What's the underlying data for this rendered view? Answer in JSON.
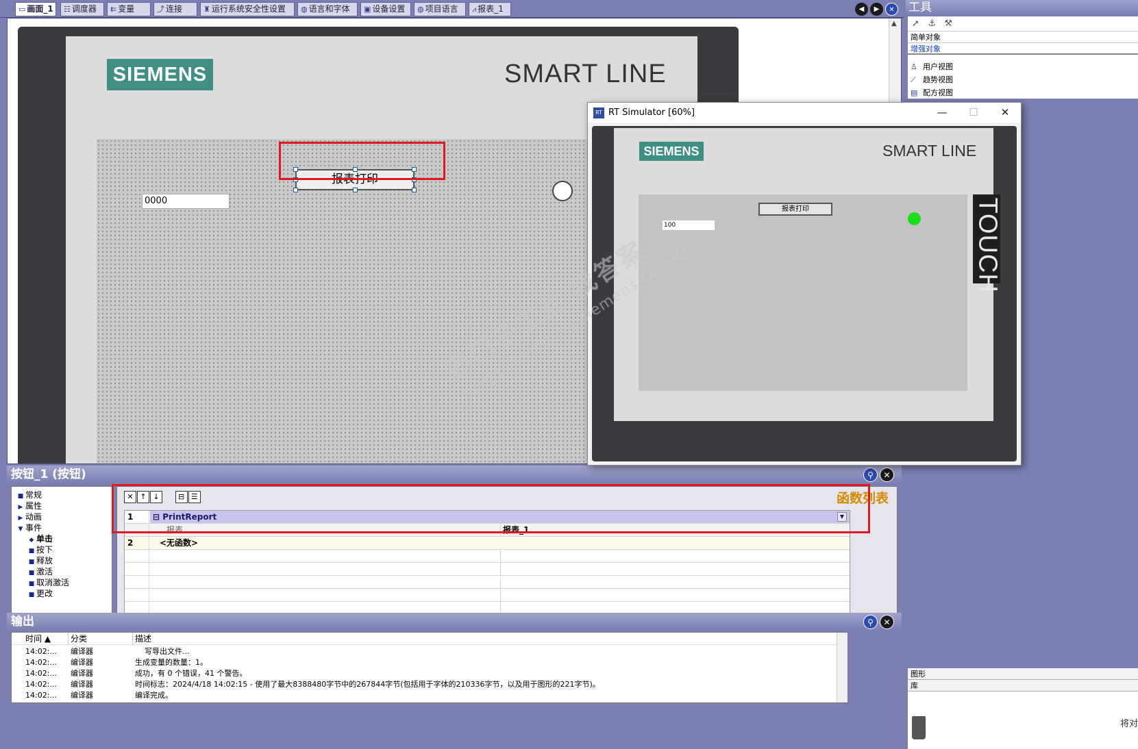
{
  "tabs": [
    {
      "label": "画面_1",
      "icon": "screen-icon",
      "active": true
    },
    {
      "label": "调度器",
      "icon": "scheduler-icon"
    },
    {
      "label": "变量",
      "icon": "variables-icon"
    },
    {
      "label": "连接",
      "icon": "connections-icon"
    },
    {
      "label": "运行系统安全性设置",
      "icon": "security-icon"
    },
    {
      "label": "语言和字体",
      "icon": "globe-icon"
    },
    {
      "label": "设备设置",
      "icon": "device-icon"
    },
    {
      "label": "项目语言",
      "icon": "globe-icon"
    },
    {
      "label": "报表_1",
      "icon": "report-icon"
    }
  ],
  "editor": {
    "logo_text": "SIEMENS",
    "device_label": "SMART LINE",
    "button_text": "报表打印",
    "io_field_value": "0000"
  },
  "properties": {
    "title": "按钮_1 (按钮)",
    "tree": [
      {
        "label": "常规",
        "marker": "■",
        "level": 0
      },
      {
        "label": "属性",
        "marker": "▶",
        "level": 0
      },
      {
        "label": "动画",
        "marker": "▶",
        "level": 0
      },
      {
        "label": "事件",
        "marker": "▼",
        "level": 0
      },
      {
        "label": "单击",
        "marker": "◆",
        "level": 1,
        "selected": true
      },
      {
        "label": "按下",
        "marker": "■",
        "level": 1
      },
      {
        "label": "释放",
        "marker": "■",
        "level": 1
      },
      {
        "label": "激活",
        "marker": "■",
        "level": 1
      },
      {
        "label": "取消激活",
        "marker": "■",
        "level": 1
      },
      {
        "label": "更改",
        "marker": "■",
        "level": 1
      }
    ],
    "function_list_title": "函数列表",
    "function_rows": [
      {
        "num": "1",
        "function": "PrintReport"
      },
      {
        "param_name": "报表",
        "param_value": "报表_1"
      },
      {
        "num": "2",
        "function": "<无函数>"
      }
    ]
  },
  "output": {
    "title": "输出",
    "columns": [
      "时间 ▲",
      "分类",
      "描述"
    ],
    "rows": [
      {
        "time": "14:02:...",
        "category": "编译器",
        "description": "    写导出文件..."
      },
      {
        "time": "14:02:...",
        "category": "编译器",
        "description": "生成变量的数量：1。"
      },
      {
        "time": "14:02:...",
        "category": "编译器",
        "description": "成功，有 0 个错误，41 个警告。"
      },
      {
        "time": "14:02:...",
        "category": "编译器",
        "description": "时间标志：2024/4/18 14:02:15 - 使用了最大8388480字节中的267844字节(包括用于字体的210336字节，以及用于图形的221字节)。"
      },
      {
        "time": "14:02:...",
        "category": "编译器",
        "description": "编译完成。"
      }
    ]
  },
  "tools": {
    "title": "工具",
    "sections": [
      "简单对象",
      "增强对象"
    ],
    "items": [
      {
        "label": "用户视图",
        "icon": "user-view-icon"
      },
      {
        "label": "趋势视图",
        "icon": "trend-view-icon"
      },
      {
        "label": "配方视图",
        "icon": "recipe-view-icon"
      }
    ],
    "bottom_sections": [
      "图形",
      "库"
    ],
    "trash_label": "将对"
  },
  "simulator": {
    "title": "RT Simulator [60%]",
    "logo_text": "SIEMENS",
    "device_label": "SMART LINE",
    "button_text": "报表打印",
    "io_field_value": "100",
    "touch_label": "TOUCH",
    "led_color": "#18e018"
  },
  "watermark": {
    "line1": "西门子工业 找答案",
    "line2": "support.industry.siemens.com/cs"
  },
  "colors": {
    "chrome": "#7b7fb2",
    "siemens_teal": "#3f8f85",
    "highlight_red": "#e0191f",
    "selected_row": "#c8c4f0"
  }
}
